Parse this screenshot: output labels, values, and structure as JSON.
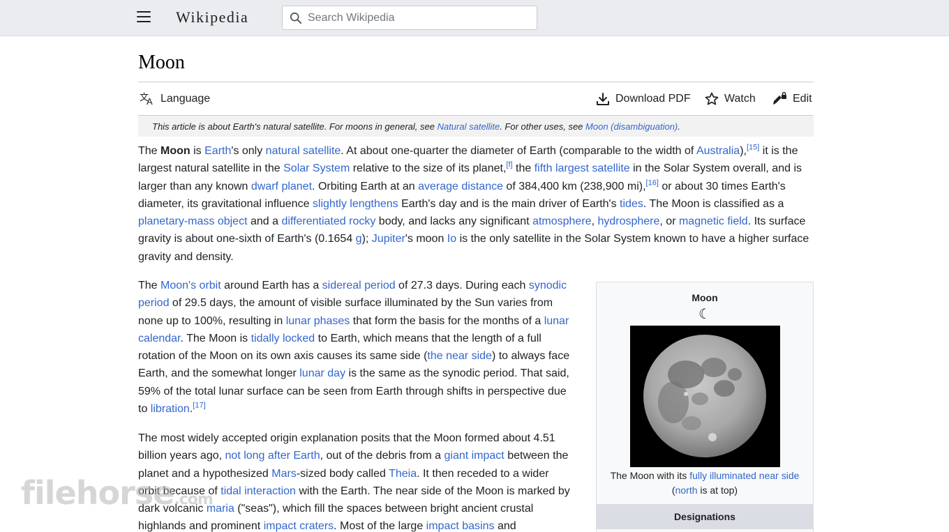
{
  "header": {
    "logo": "Wikipedia",
    "search_placeholder": "Search Wikipedia"
  },
  "page": {
    "title": "Moon",
    "toolbar": {
      "language": "Language",
      "download_pdf": "Download PDF",
      "watch": "Watch",
      "edit": "Edit"
    },
    "hatnote": {
      "t1": "This article is about Earth's natural satellite. For moons in general, see ",
      "l1": "Natural satellite",
      "t2": ". For other uses, see ",
      "l2": "Moon (disambiguation)",
      "t3": "."
    }
  },
  "p1": {
    "s1": "The ",
    "b1": "Moon",
    "s2": " is ",
    "l1": "Earth",
    "s3": "'s only ",
    "l2": "natural satellite",
    "s4": ". At about one-quarter the diameter of Earth (comparable to the width of ",
    "l3": "Australia",
    "s5": "),",
    "r1": "[15]",
    "s6": " it is the largest natural satellite in the ",
    "l4": "Solar System",
    "s7": " relative to the size of its planet,",
    "r2": "[f]",
    "s8": " the ",
    "l5": "fifth largest satellite",
    "s9": " in the Solar System overall, and is larger than any known ",
    "l6": "dwarf planet",
    "s10": ". Orbiting Earth at an ",
    "l7": "average distance",
    "s11": " of 384,400 km (238,900 mi),",
    "r3": "[16]",
    "s12": " or about 30 times Earth's diameter, its gravitational influence ",
    "l8": "slightly lengthens",
    "s13": " Earth's day and is the main driver of Earth's ",
    "l9": "tides",
    "s14": ". The Moon is classified as a ",
    "l10": "planetary-mass object",
    "s15": " and a ",
    "l11": "differentiated rocky",
    "s16": " body, and lacks any significant ",
    "l12": "atmosphere",
    "s17": ", ",
    "l13": "hydrosphere",
    "s18": ", or ",
    "l14": "magnetic field",
    "s19": ". Its surface gravity is about one-sixth of Earth's (0.1654 ",
    "l15": "g",
    "s20": "); ",
    "l16": "Jupiter",
    "s21": "'s moon ",
    "l17": "Io",
    "s22": " is the only satellite in the Solar System known to have a higher surface gravity and density."
  },
  "p2": {
    "s1": "The ",
    "l1": "Moon's orbit",
    "s2": " around Earth has a ",
    "l2": "sidereal period",
    "s3": " of 27.3 days. During each ",
    "l3": "synodic period",
    "s4": " of 29.5 days, the amount of visible surface illuminated by the Sun varies from none up to 100%, resulting in ",
    "l4": "lunar phases",
    "s5": " that form the basis for the months of a ",
    "l5": "lunar calendar",
    "s6": ". The Moon is ",
    "l6": "tidally locked",
    "s7": " to Earth, which means that the length of a full rotation of the Moon on its own axis causes its same side (",
    "l7": "the near side",
    "s8": ") to always face Earth, and the somewhat longer ",
    "l8": "lunar day",
    "s9": " is the same as the synodic period. That said, 59% of the total lunar surface can be seen from Earth through shifts in perspective due to ",
    "l9": "libration",
    "s10": ".",
    "r1": "[17]"
  },
  "p3": {
    "s1": "The most widely accepted origin explanation posits that the Moon formed about 4.51 billion years ago, ",
    "l1": "not long after Earth",
    "s2": ", out of the debris from a ",
    "l2": "giant impact",
    "s3": " between the planet and a hypothesized ",
    "l3": "Mars",
    "s4": "-sized body called ",
    "l4": "Theia",
    "s5": ". It then receded to a wider orbit because of ",
    "l5": "tidal interaction",
    "s6": " with the Earth. The near side of the Moon is marked by dark volcanic ",
    "l6": "maria",
    "s7": " (\"seas\"), which fill the spaces between bright ancient crustal highlands and prominent ",
    "l7": "impact craters",
    "s8": ". Most of the large ",
    "l8": "impact basins",
    "s9": " and"
  },
  "infobox": {
    "title": "Moon",
    "symbol": "☾",
    "caption_t1": "The Moon with its ",
    "caption_l1": "fully illuminated near side",
    "caption_t2": "(",
    "caption_l2": "north",
    "caption_t3": " is at top)",
    "section": "Designations"
  },
  "watermark": {
    "text": "filehorse",
    "domain": ".com"
  }
}
